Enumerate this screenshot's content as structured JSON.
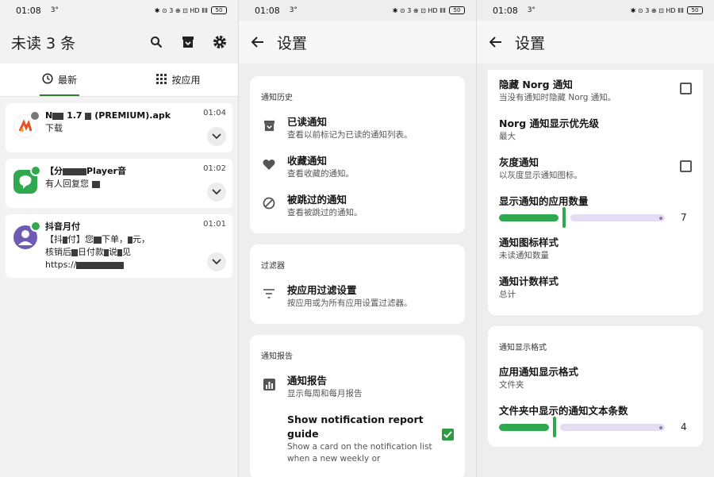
{
  "status": {
    "time": "01:08",
    "sup": "3°",
    "indicators": "✱ ⊙ 3 ⊕ ⊡ HD ⅡⅡ",
    "battery": "50"
  },
  "screen1": {
    "title": "未读 3 条",
    "icons": [
      "search-icon",
      "archive-icon",
      "gear-icon"
    ],
    "tabs": [
      {
        "label": "最新"
      },
      {
        "label": "按应用"
      }
    ],
    "notifications": [
      {
        "app_color": "#ffffff",
        "badge_color": "#777777",
        "title_a": "N",
        "title_b": "1.7",
        "title_c": "(PREMIUM).apk",
        "line1": "下载",
        "time": "01:04"
      },
      {
        "app_color": "#2fa84f",
        "badge_color": "#2fa84f",
        "title_a": "【分",
        "title_b": "Player音",
        "line1": "有人回复您",
        "time": "01:02"
      },
      {
        "app_color": "#6f5bb5",
        "badge_color": "#2fa84f",
        "title_a": "抖音月付",
        "line1": "【抖",
        "line1b": "付】您",
        "line1c": "下单，",
        "line1d": "元，",
        "line2": "核销后",
        "line2b": "日付款",
        "line2c": "说",
        "line2d": "见",
        "line3": "https://",
        "time": "01:01"
      }
    ]
  },
  "screen2": {
    "title": "设置",
    "sections": [
      {
        "title": "通知历史",
        "rows": [
          {
            "title": "已读通知",
            "sub": "查看以前标记为已读的通知列表。"
          },
          {
            "title": "收藏通知",
            "sub": "查看收藏的通知。"
          },
          {
            "title": "被跳过的通知",
            "sub": "查看被跳过的通知。"
          }
        ]
      },
      {
        "title": "过滤器",
        "rows": [
          {
            "title": "按应用过滤设置",
            "sub": "按应用或为所有应用设置过滤器。"
          }
        ]
      },
      {
        "title": "通知报告",
        "rows": [
          {
            "title": "通知报告",
            "sub": "显示每周和每月报告"
          },
          {
            "title": "Show notification report guide",
            "sub": "Show a card on the notification list when a new weekly or",
            "checked": true
          }
        ]
      }
    ]
  },
  "screen3": {
    "title": "设置",
    "rows": [
      {
        "title": "隐藏 Norg 通知",
        "sub": "当没有通知时隐藏 Norg 通知。",
        "checked": false
      },
      {
        "title": "Norg 通知显示优先级",
        "sub": "最大"
      },
      {
        "title": "灰度通知",
        "sub": "以灰度显示通知图标。",
        "checked": false
      },
      {
        "title": "显示通知的应用数量",
        "slider_value": "7",
        "slider_fraction": 0.4
      },
      {
        "title": "通知图标样式",
        "sub": "未读通知数量"
      },
      {
        "title": "通知计数样式",
        "sub": "总计"
      }
    ],
    "section2": {
      "title": "通知显示格式",
      "rows": [
        {
          "title": "应用通知显示格式",
          "sub": "文件夹"
        },
        {
          "title": "文件夹中显示的通知文本条数",
          "slider_value": "4",
          "slider_fraction": 0.33
        }
      ]
    }
  }
}
